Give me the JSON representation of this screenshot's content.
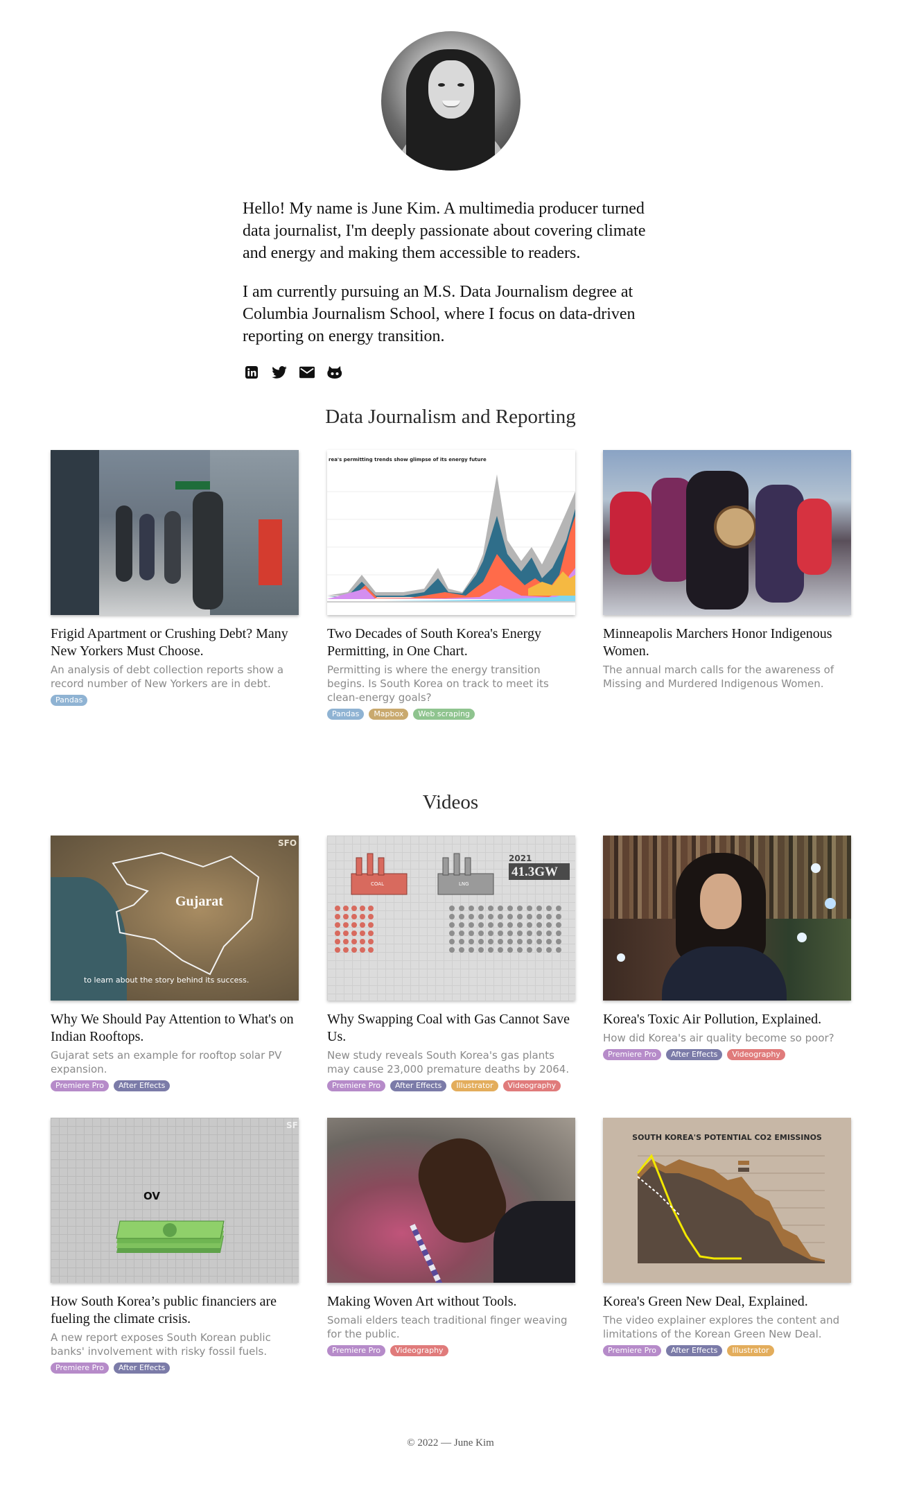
{
  "bio": {
    "paragraph1": "Hello! My name is June Kim. A multimedia producer turned data journalist, I'm deeply passionate about covering climate and energy and making them accessible to readers.",
    "paragraph2": "I am currently pursuing an M.S. Data Journalism degree at Columbia Journalism School, where I focus on data-driven reporting on energy transition."
  },
  "social": [
    "linkedin-icon",
    "twitter-icon",
    "email-icon",
    "github-icon"
  ],
  "sections": {
    "data_title": "Data Journalism and Reporting",
    "videos_title": "Videos"
  },
  "tag_colors": {
    "Pandas": "#8fb3d3",
    "Mapbox": "#c9a96e",
    "Web scraping": "#8fc48f",
    "Premiere Pro": "#b68bc9",
    "After Effects": "#7b7ba8",
    "Illustrator": "#e3ad5c",
    "Videography": "#e07b7b"
  },
  "data_cards": [
    {
      "title": "Frigid Apartment or Crushing Debt? Many New Yorkers Must Choose.",
      "desc": "An analysis of debt collection reports show a record number of New Yorkers are in debt.",
      "tags": [
        "Pandas"
      ]
    },
    {
      "title": "Two Decades of South Korea's Energy Permitting, in One Chart.",
      "desc": "Permitting is where the energy transition begins. Is South Korea on track to meet its clean-energy goals?",
      "tags": [
        "Pandas",
        "Mapbox",
        "Web scraping"
      ],
      "thumb_heading": "rea's permitting trends show glimpse of its energy future"
    },
    {
      "title": "Minneapolis Marchers Honor Indigenous Women.",
      "desc": "The annual march calls for the awareness of Missing and Murdered Indigenous Women.",
      "tags": []
    }
  ],
  "video_cards": [
    {
      "title": "Why We Should Pay Attention to What's on Indian Rooftops.",
      "desc": "Gujarat sets an example for rooftop solar PV expansion.",
      "tags": [
        "Premiere Pro",
        "After Effects"
      ],
      "thumb_label": "Gujarat",
      "thumb_caption": "to learn about the story behind its success.",
      "thumb_corner": "SFO"
    },
    {
      "title": "Why Swapping Coal with Gas Cannot Save Us.",
      "desc": "New study reveals South Korea's gas plants may cause 23,000 premature deaths by 2064.",
      "tags": [
        "Premiere Pro",
        "After Effects",
        "Illustrator",
        "Videography"
      ],
      "thumb_year": "2021",
      "thumb_value": "41.3GW",
      "thumb_coal": "COAL",
      "thumb_lng": "LNG"
    },
    {
      "title": "Korea's Toxic Air Pollution, Explained.",
      "desc": "How did Korea's air quality become so poor?",
      "tags": [
        "Premiere Pro",
        "After Effects",
        "Videography"
      ]
    },
    {
      "title": "How South Korea’s public financiers are fueling the climate crisis.",
      "desc": "A new report exposes South Korean public banks' involvement with risky fossil fuels.",
      "tags": [
        "Premiere Pro",
        "After Effects"
      ],
      "thumb_text": "OV",
      "thumb_corner": "SF"
    },
    {
      "title": "Making Woven Art without Tools.",
      "desc": "Somali elders teach traditional finger weaving for the public.",
      "tags": [
        "Premiere Pro",
        "Videography"
      ]
    },
    {
      "title": "Korea's Green New Deal, Explained.",
      "desc": "The video explainer explores the content and limitations of the Korean Green New Deal.",
      "tags": [
        "Premiere Pro",
        "After Effects",
        "Illustrator"
      ],
      "thumb_heading": "SOUTH KOREA'S POTENTIAL CO2 EMISSINOS"
    }
  ],
  "footer": "© 2022 — June Kim"
}
